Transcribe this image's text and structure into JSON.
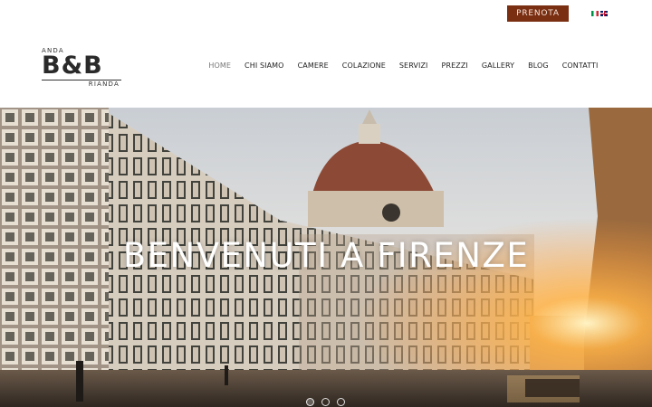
{
  "topbar": {
    "book_label": "PRENOTA",
    "languages": [
      {
        "code": "it",
        "icon": "italy-flag-icon"
      },
      {
        "code": "en",
        "icon": "uk-flag-icon"
      }
    ]
  },
  "logo": {
    "top": "ANDA",
    "main": "B&B",
    "bottom": "RIANDA"
  },
  "nav": {
    "items": [
      {
        "label": "HOME",
        "active": true
      },
      {
        "label": "CHI SIAMO"
      },
      {
        "label": "CAMERE"
      },
      {
        "label": "COLAZIONE"
      },
      {
        "label": "SERVIZI"
      },
      {
        "label": "PREZZI"
      },
      {
        "label": "GALLERY"
      },
      {
        "label": "BLOG"
      },
      {
        "label": "CONTATTI"
      }
    ]
  },
  "hero": {
    "title": "BENVENUTI A FIRENZE",
    "slides": 3,
    "active_slide": 1
  },
  "colors": {
    "accent": "#7a2e12",
    "sky": "#d9dee3",
    "sun": "#ffb347"
  }
}
